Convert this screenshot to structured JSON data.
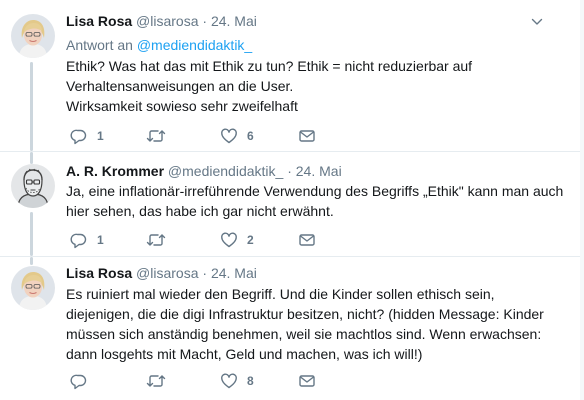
{
  "tweets": [
    {
      "name": "Lisa Rosa",
      "handle": "@lisarosa",
      "separator": "·",
      "time": "24. Mai",
      "replying_prefix": "Antwort an",
      "replying_to": "@mediendidaktik_",
      "lines": [
        "Ethik? Was hat das mit Ethik zu tun? Ethik = nicht reduzierbar auf",
        "Verhaltensanweisungen an die User.",
        "Wirksamkeit sowieso sehr zweifelhaft"
      ],
      "replies": "1",
      "retweets": "",
      "likes": "6"
    },
    {
      "name": "A. R. Krommer",
      "handle": "@mediendidaktik_",
      "separator": "·",
      "time": "24. Mai",
      "lines": [
        "Ja, eine inflationär-irreführende Verwendung des Begriffs „Ethik\" kann man auch",
        "hier sehen, das habe ich gar nicht erwähnt."
      ],
      "replies": "1",
      "retweets": "",
      "likes": "2"
    },
    {
      "name": "Lisa Rosa",
      "handle": "@lisarosa",
      "separator": "·",
      "time": "24. Mai",
      "lines": [
        "Es ruiniert mal wieder den Begriff. Und die Kinder sollen ethisch sein,",
        "diejenigen, die die digi Infrastruktur besitzen, nicht? (hidden Message: Kinder",
        "müssen sich anständig benehmen, weil sie machtlos sind. Wenn erwachsen:",
        "dann losgehts mit Macht, Geld und machen, was ich will!)"
      ],
      "replies": "",
      "retweets": "",
      "likes": "8"
    }
  ],
  "colors": {
    "text": "#14171a",
    "secondary": "#657786",
    "link": "#1da1f2",
    "thread_line": "#ccd6dd",
    "divider": "#e6ecf0"
  },
  "icons": [
    "chevron-down-icon",
    "reply-icon",
    "retweet-icon",
    "like-icon",
    "direct-message-icon"
  ]
}
